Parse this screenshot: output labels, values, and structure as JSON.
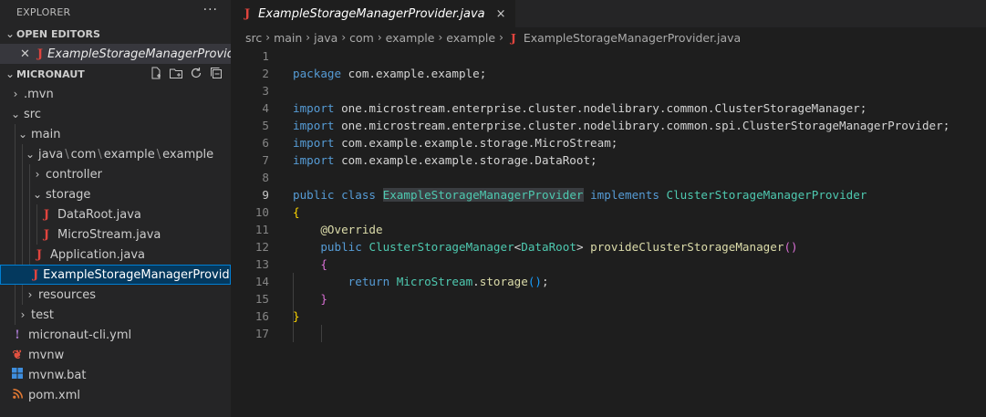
{
  "explorer": {
    "title": "EXPLORER",
    "more_label": "···",
    "open_editors": {
      "label": "OPEN EDITORS",
      "items": [
        {
          "name": "ExampleStorageManagerProvide..."
        }
      ]
    },
    "project": {
      "label": "MICRONAUT",
      "tree": {
        "mvn": ".mvn",
        "src": "src",
        "main": "main",
        "java_path": [
          "java",
          "com",
          "example",
          "example"
        ],
        "controller": "controller",
        "storage": "storage",
        "dataroot": "DataRoot.java",
        "microstream": "MicroStream.java",
        "application": "Application.java",
        "provider": "ExampleStorageManagerProvide...",
        "resources": "resources",
        "test": "test",
        "cli_yml": "micronaut-cli.yml",
        "mvnw": "mvnw",
        "mvnw_bat": "mvnw.bat",
        "pom": "pom.xml"
      }
    }
  },
  "editor": {
    "tab": {
      "title": "ExampleStorageManagerProvider.java",
      "close": "×"
    },
    "breadcrumbs": [
      "src",
      "main",
      "java",
      "com",
      "example",
      "example",
      "ExampleStorageManagerProvider.java"
    ],
    "active_line": 9,
    "line_numbers": [
      "1",
      "2",
      "3",
      "4",
      "5",
      "6",
      "7",
      "8",
      "9",
      "10",
      "11",
      "12",
      "13",
      "14",
      "15",
      "16",
      "17"
    ],
    "code": {
      "l2": {
        "kw": "package",
        "rest": " com.example.example;"
      },
      "l4": {
        "kw": "import",
        "rest": " one.microstream.enterprise.cluster.nodelibrary.common.ClusterStorageManager;"
      },
      "l5": {
        "kw": "import",
        "rest": " one.microstream.enterprise.cluster.nodelibrary.common.spi.ClusterStorageManagerProvider;"
      },
      "l6": {
        "kw": "import",
        "rest": " com.example.example.storage.MicroStream;"
      },
      "l7": {
        "kw": "import",
        "rest": " com.example.example.storage.DataRoot;"
      },
      "l9": {
        "kw1": "public",
        "kw2": "class",
        "cls": "ExampleStorageManagerProvider",
        "kw3": "implements",
        "iface": "ClusterStorageManagerProvider"
      },
      "l10": {
        "brace": "{"
      },
      "l11": {
        "ann": "@Override"
      },
      "l12": {
        "kw": "public",
        "type1": "ClusterStorageManager",
        "lt": "<",
        "type2": "DataRoot",
        "gt": ">",
        "fn": "provideClusterStorageManager",
        "parens": "()"
      },
      "l13": {
        "brace": "{"
      },
      "l14": {
        "kw": "return",
        "type": "MicroStream",
        "dot": ".",
        "fn": "storage",
        "parens": "()",
        "semi": ";"
      },
      "l15": {
        "brace": "}"
      },
      "l16": {
        "brace": "}"
      }
    }
  }
}
